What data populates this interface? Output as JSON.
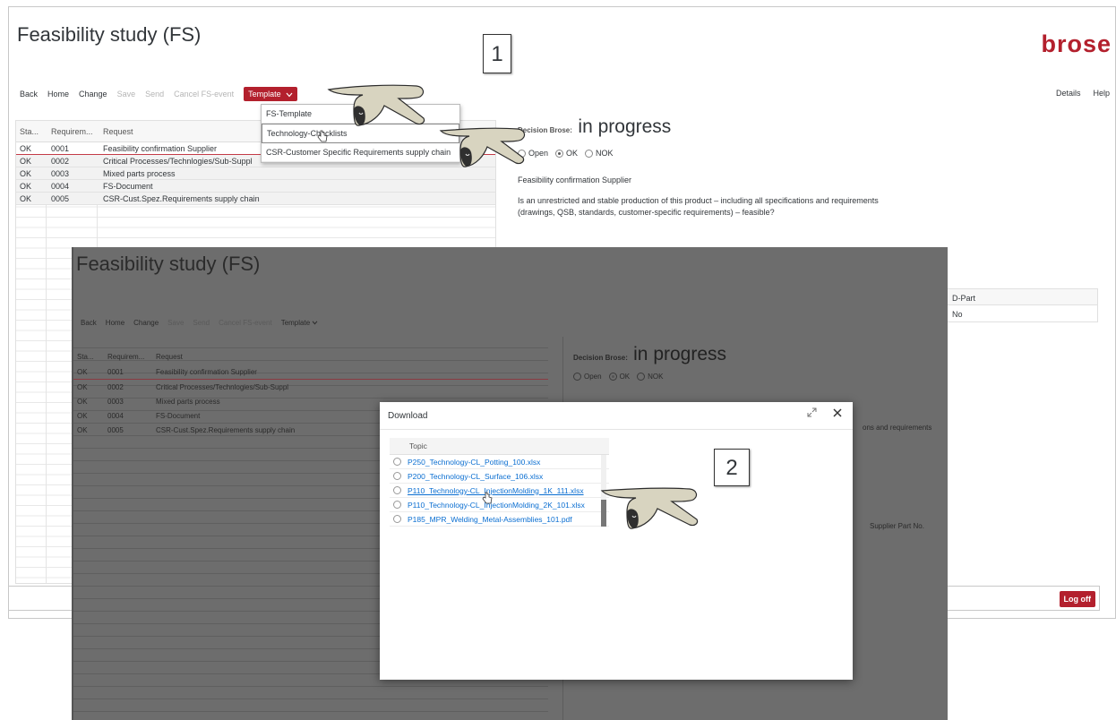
{
  "window1": {
    "title": "Feasibility study (FS)",
    "brand": "brose",
    "toolbar": {
      "back": "Back",
      "home": "Home",
      "change": "Change",
      "save": "Save",
      "send": "Send",
      "cancel_fs_event": "Cancel FS-event",
      "template": "Template",
      "details": "Details",
      "help": "Help"
    },
    "template_menu": [
      "FS-Template",
      "Technology-Checklists",
      "CSR-Customer Specific Requirements supply chain"
    ],
    "grid": {
      "columns": [
        "Sta...",
        "Requirem...",
        "Request"
      ],
      "rows": [
        [
          "OK",
          "0001",
          "Feasibility confirmation Supplier"
        ],
        [
          "OK",
          "0002",
          "Critical Processes/Technlogies/Sub-Suppl"
        ],
        [
          "OK",
          "0003",
          "Mixed parts process"
        ],
        [
          "OK",
          "0004",
          "FS-Document"
        ],
        [
          "OK",
          "0005",
          "CSR-Cust.Spez.Requirements supply chain"
        ]
      ]
    },
    "detail": {
      "decision_label": "Decision Brose:",
      "decision_value": "in progress",
      "radio_open": "Open",
      "radio_ok": "OK",
      "radio_nok": "NOK",
      "title": "Feasibility confirmation Supplier",
      "text": "Is an unrestricted and stable production of this product – including all specifications and requirements (drawings, QSB, standards, customer-specific requirements) – feasible?"
    },
    "dpart": {
      "header": "D-Part",
      "value": "No"
    },
    "logoff": "Log off"
  },
  "window2": {
    "title": "Feasibility study (FS)",
    "toolbar": {
      "back": "Back",
      "home": "Home",
      "change": "Change",
      "save": "Save",
      "send": "Send",
      "cancel_fs_event": "Cancel FS-event",
      "template": "Template"
    },
    "grid": {
      "columns": [
        "Sta...",
        "Requirem...",
        "Request"
      ],
      "rows": [
        [
          "OK",
          "0001",
          "Feasibility confirmation Supplier"
        ],
        [
          "OK",
          "0002",
          "Critical Processes/Technlogies/Sub-Suppl"
        ],
        [
          "OK",
          "0003",
          "Mixed parts process"
        ],
        [
          "OK",
          "0004",
          "FS-Document"
        ],
        [
          "OK",
          "0005",
          "CSR-Cust.Spez.Requirements supply chain"
        ]
      ]
    },
    "detail": {
      "decision_label": "Decision Brose:",
      "decision_value": "in progress",
      "radio_open": "Open",
      "radio_ok": "OK",
      "radio_nok": "NOK"
    },
    "fragment_text": "ons and requirements",
    "fragment_col": "Supplier Part No."
  },
  "dialog": {
    "title": "Download",
    "column": "Topic",
    "files": [
      "P250_Technology-CL_Potting_100.xlsx",
      "P200_Technology-CL_Surface_106.xlsx",
      "P110_Technology-CL_InjectionMolding_1K_111.xlsx",
      "P110_Technology-CL_InjectionMolding_2K_101.xlsx",
      "P185_MPR_Welding_Metal-Assemblies_101.pdf"
    ]
  },
  "callouts": {
    "step1": "1",
    "step2": "2"
  },
  "icons": {
    "template_chevron": "chevron-down-icon",
    "expand": "expand-icon",
    "close": "close-icon",
    "pointer": "pointing-hand-icon",
    "cursor": "hand-cursor-icon"
  },
  "colors": {
    "accent": "#b3202d",
    "link": "#0a6ed1",
    "overlay": "#6d6d6d"
  }
}
